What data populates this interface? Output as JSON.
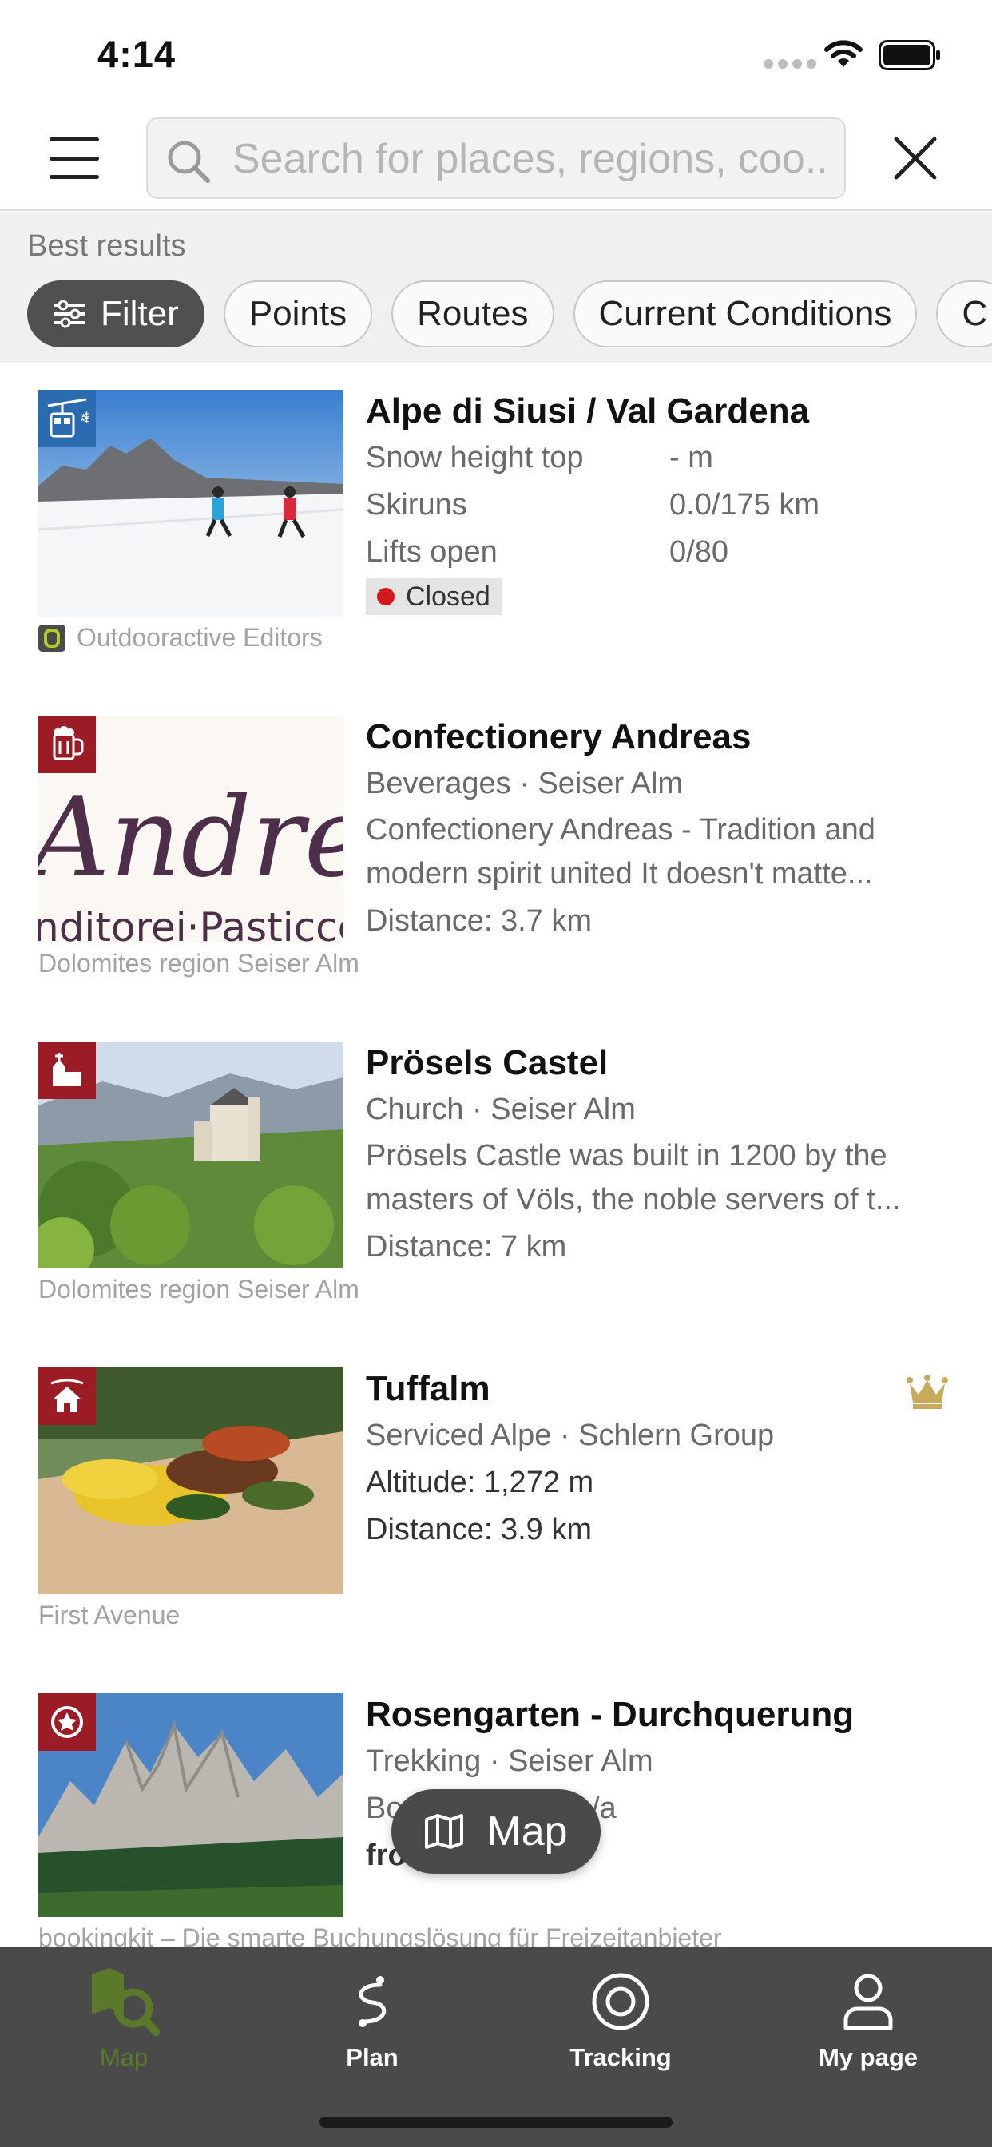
{
  "status_bar": {
    "time": "4:14"
  },
  "search": {
    "placeholder": "Search for places, regions, coo..."
  },
  "filters": {
    "section_label": "Best results",
    "chips": [
      "Filter",
      "Points",
      "Routes",
      "Current Conditions",
      "C"
    ]
  },
  "results": [
    {
      "title": "Alpe di Siusi / Val Gardena",
      "category_icon": "cable-car-snowflake-icon",
      "stats": [
        {
          "label": "Snow height top",
          "value": "- m"
        },
        {
          "label": "Skiruns",
          "value": "0.0/175 km"
        },
        {
          "label": "Lifts open",
          "value": "0/80"
        }
      ],
      "status": "Closed",
      "status_color": "#d11919",
      "credit": "Outdooractive Editors"
    },
    {
      "title": "Confectionery Andreas",
      "category_icon": "beer-mug-icon",
      "subtitle": "Beverages · Seiser Alm",
      "description_1": "Confectionery Andreas - Tradition and",
      "description_2": "modern spirit united It doesn't matte...",
      "distance": "Distance: 3.7 km",
      "thumb_text_main": "Andrea",
      "thumb_text_sub": "nditorei·Pasticcer",
      "credit": "Dolomites region Seiser Alm"
    },
    {
      "title": "Prösels Castel",
      "category_icon": "church-icon",
      "subtitle": "Church · Seiser Alm",
      "description_1": "Prösels Castle was built in 1200 by the",
      "description_2": "masters of Völs, the noble servers of t...",
      "distance": "Distance: 7 km",
      "credit": "Dolomites region Seiser Alm"
    },
    {
      "title": "Tuffalm",
      "category_icon": "hut-icon",
      "subtitle": "Serviced Alpe · Schlern Group",
      "altitude": "Altitude: 1,272 m",
      "distance": "Distance: 3.9 km",
      "premium_icon": "crown-icon",
      "credit": "First Avenue"
    },
    {
      "title": "Rosengarten - Durchquerung",
      "category_icon": "trekking-icon",
      "subtitle": "Trekking · Seiser Alm",
      "line_partial_1": "Bo",
      "line_partial_2": "/a",
      "line_partial_3": "fro",
      "credit": "bookingkit – Die smarte Buchungslösung für Freizeitanbieter"
    }
  ],
  "map_button": {
    "label": "Map"
  },
  "tabs": [
    {
      "label": "Map",
      "icon": "map-pin-icon",
      "active": true
    },
    {
      "label": "Plan",
      "icon": "route-icon",
      "active": false
    },
    {
      "label": "Tracking",
      "icon": "tracking-icon",
      "active": false
    },
    {
      "label": "My page",
      "icon": "user-icon",
      "active": false
    }
  ],
  "colors": {
    "accent_green": "#5a7a2a",
    "category_red": "#9b1c24",
    "category_blue": "#2b6cb0",
    "premium_gold": "#c9a95b",
    "tab_bar": "#4a4a4a"
  }
}
